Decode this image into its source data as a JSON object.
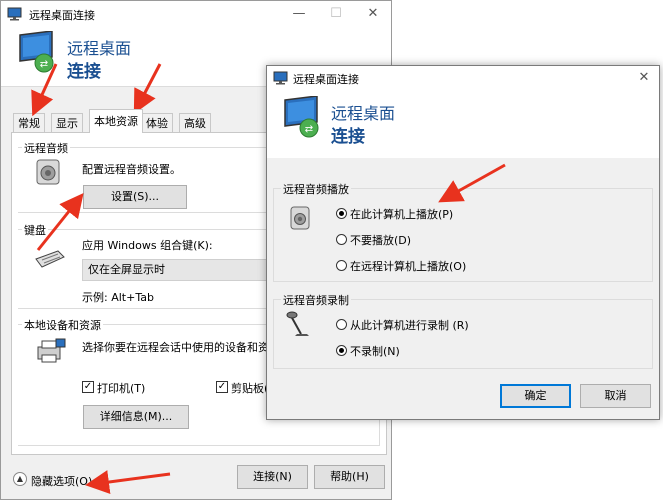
{
  "main": {
    "title": "远程桌面连接",
    "controls": {
      "minimize": "—",
      "maximize": "☐",
      "close": "✕"
    },
    "banner": {
      "line1": "远程桌面",
      "line2": "连接"
    },
    "tabs": [
      {
        "label": "常规"
      },
      {
        "label": "显示"
      },
      {
        "label": "本地资源"
      },
      {
        "label": "体验"
      },
      {
        "label": "高级"
      }
    ],
    "active_tab": "本地资源",
    "audio": {
      "title": "远程音频",
      "description": "配置远程音频设置。",
      "settings_button": "设置(S)..."
    },
    "keyboard": {
      "title": "键盘",
      "description": "应用 Windows 组合键(K):",
      "selected": "仅在全屏显示时",
      "example": "示例: Alt+Tab"
    },
    "devices": {
      "title": "本地设备和资源",
      "description": "选择你要在远程会话中使用的设备和资源。",
      "printer_label": "打印机(T)",
      "printer_checked": true,
      "clipboard_label": "剪贴板(L)",
      "clipboard_checked": true,
      "details_button": "详细信息(M)..."
    },
    "hide_options": "隐藏选项(O)",
    "connect_button": "连接(N)",
    "help_button": "帮助(H)"
  },
  "dialog": {
    "title": "远程桌面连接",
    "close": "✕",
    "banner": {
      "line1": "远程桌面",
      "line2": "连接"
    },
    "playback": {
      "title": "远程音频播放",
      "options": [
        {
          "label": "在此计算机上播放(P)",
          "selected": true
        },
        {
          "label": "不要播放(D)",
          "selected": false
        },
        {
          "label": "在远程计算机上播放(O)",
          "selected": false
        }
      ]
    },
    "recording": {
      "title": "远程音频录制",
      "options": [
        {
          "label": "从此计算机进行录制 (R)",
          "selected": false
        },
        {
          "label": "不录制(N)",
          "selected": true
        }
      ]
    },
    "ok_button": "确定",
    "cancel_button": "取消"
  },
  "colors": {
    "banner_text": "#1a4f91",
    "annotation_arrow": "#e8321e",
    "focus_border": "#0078d7"
  }
}
